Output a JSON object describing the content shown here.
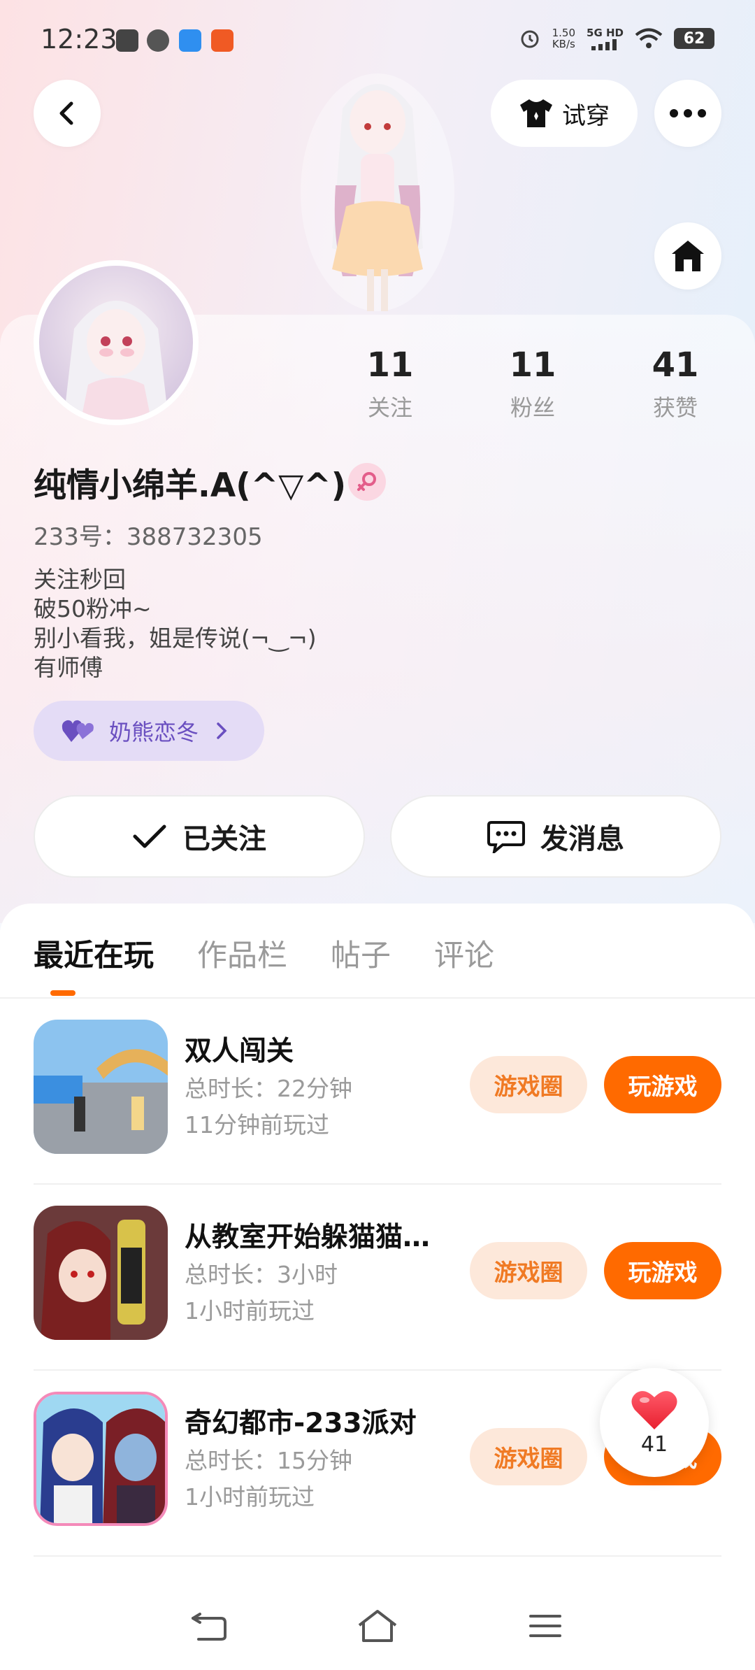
{
  "status_bar": {
    "time": "12:23",
    "net_speed_value": "1.50",
    "net_speed_unit": "KB/s",
    "signal_label": "5G HD",
    "battery": "62"
  },
  "header": {
    "tryon_label": "试穿",
    "icons": [
      "back-arrow-icon",
      "tshirt-icon",
      "more-dots-icon",
      "home-icon"
    ]
  },
  "profile": {
    "stats": [
      {
        "value": "11",
        "label": "关注"
      },
      {
        "value": "11",
        "label": "粉丝"
      },
      {
        "value": "41",
        "label": "获赞"
      }
    ],
    "nickname": "纯情小绵羊.A(^▽^)",
    "uid": "233号：388732305",
    "bio": [
      "关注秒回",
      "破50粉冲~",
      "别小看我，姐是传说(¬‿¬)",
      "有师傅"
    ],
    "group_label": "奶熊恋冬",
    "follow_label": "已关注",
    "message_label": "发消息"
  },
  "tabs": [
    "最近在玩",
    "作品栏",
    "帖子",
    "评论"
  ],
  "games": [
    {
      "title": "双人闯关",
      "duration": "总时长：22分钟",
      "last_played": "11分钟前玩过",
      "circle_label": "游戏圈",
      "play_label": "玩游戏"
    },
    {
      "title": "从教室开始躲猫猫…",
      "duration": "总时长：3小时",
      "last_played": "1小时前玩过",
      "circle_label": "游戏圈",
      "play_label": "玩游戏"
    },
    {
      "title": "奇幻都市-233派对",
      "duration": "总时长：15分钟",
      "last_played": "1小时前玩过",
      "circle_label": "游戏圈",
      "play_label": "玩游戏"
    }
  ],
  "like_float": {
    "count": "41"
  },
  "colors": {
    "accent": "#ff6a00",
    "chip_bg": "#fde8da",
    "group_chip_bg": "#e4dcf6",
    "group_chip_text": "#6a4fc0"
  }
}
